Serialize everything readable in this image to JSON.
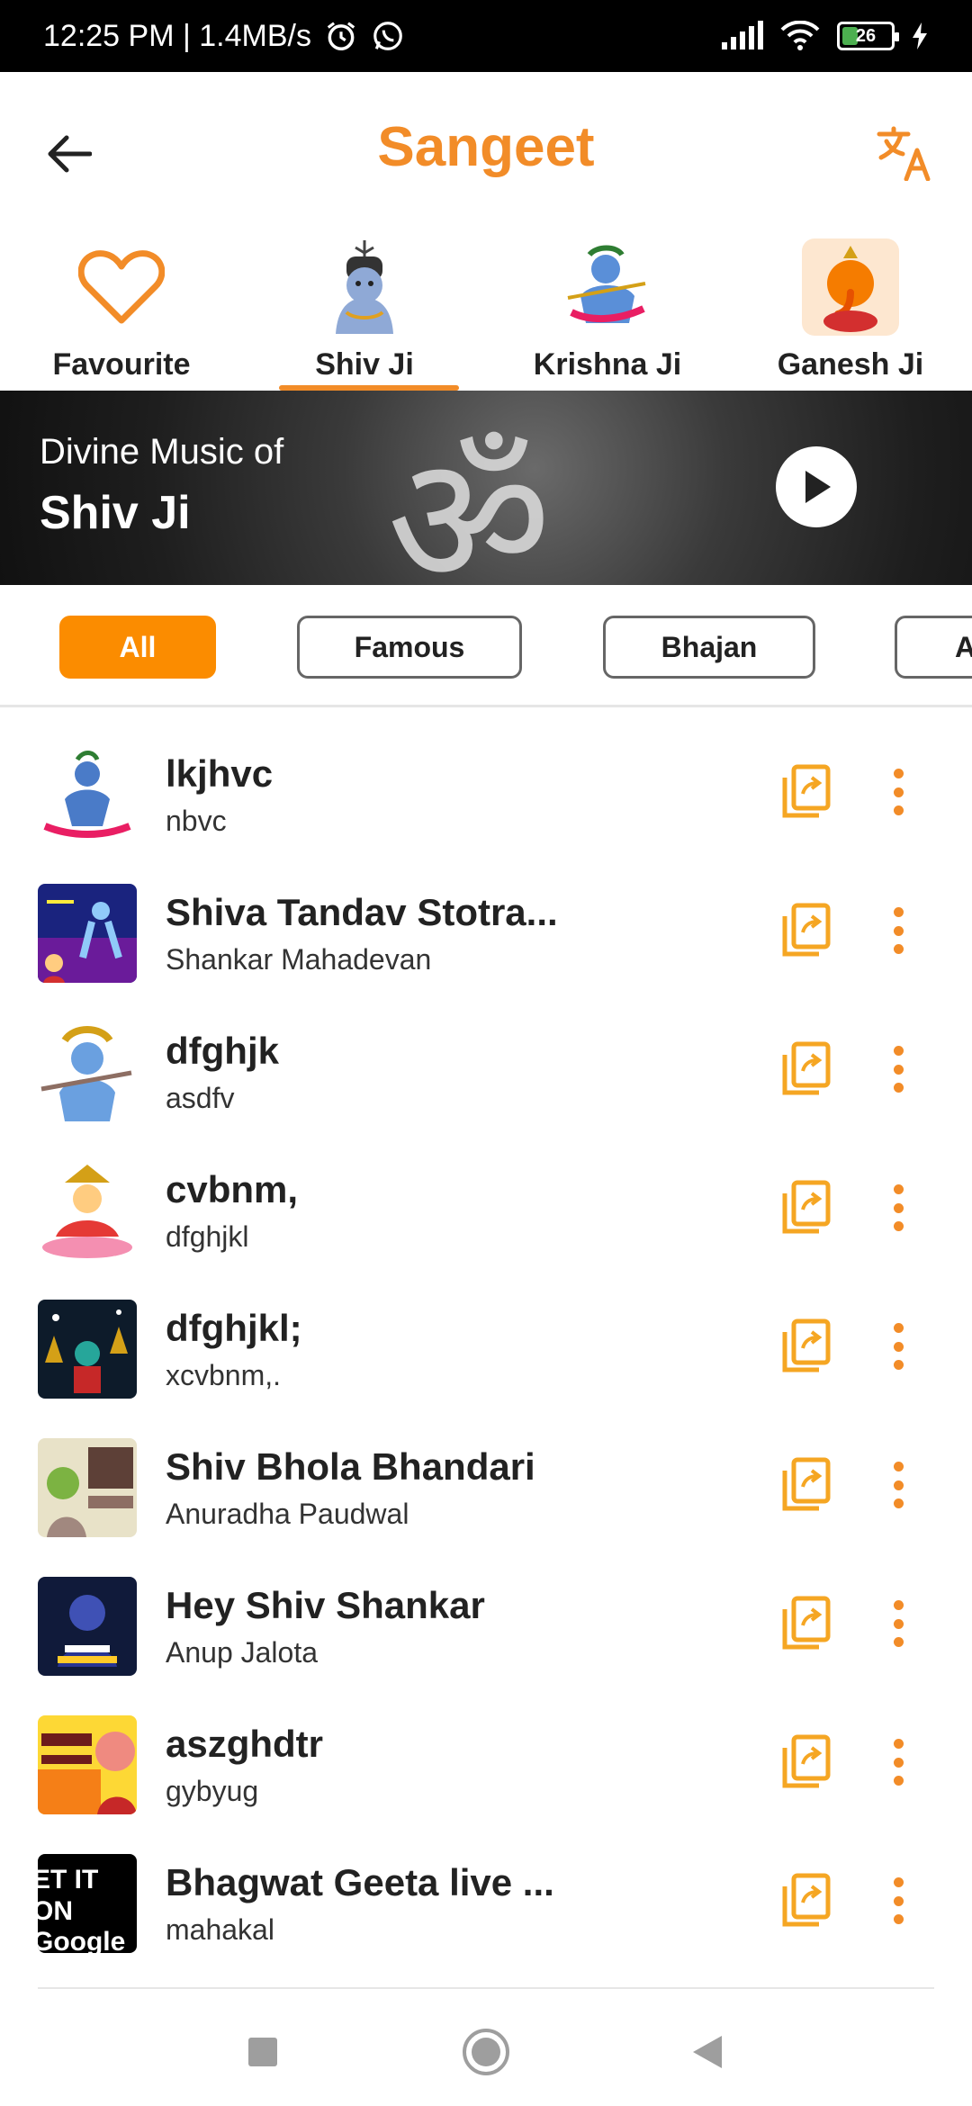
{
  "status_bar": {
    "time_speed": "12:25 PM | 1.4MB/s",
    "battery": "26",
    "icons": [
      "alarm-icon",
      "whatsapp-icon",
      "signal-icon",
      "wifi-icon",
      "battery-icon",
      "charging-icon"
    ]
  },
  "app_bar": {
    "title": "Sangeet",
    "back_icon": "back-arrow-icon",
    "translate_icon": "translate-icon"
  },
  "tabs": [
    {
      "label": "Favourite",
      "icon": "heart-icon"
    },
    {
      "label": "Shiv Ji",
      "icon": "shiv-ji-image"
    },
    {
      "label": "Krishna Ji",
      "icon": "krishna-ji-image"
    },
    {
      "label": "Ganesh Ji",
      "icon": "ganesh-ji-image"
    }
  ],
  "active_tab": "Shiv Ji",
  "banner": {
    "line1": "Divine Music of",
    "line2": "Shiv Ji"
  },
  "filters": [
    "All",
    "Famous",
    "Bhajan",
    "A"
  ],
  "active_filter": "All",
  "songs": [
    {
      "title": "lkjhvc",
      "subtitle": "nbvc"
    },
    {
      "title": "Shiva Tandav Stotra...",
      "subtitle": "Shankar Mahadevan"
    },
    {
      "title": "dfghjk",
      "subtitle": "asdfv"
    },
    {
      "title": "cvbnm,",
      "subtitle": "dfghjkl"
    },
    {
      "title": "dfghjkl;",
      "subtitle": "xcvbnm,."
    },
    {
      "title": "Shiv Bhola Bhandari",
      "subtitle": "Anuradha Paudwal"
    },
    {
      "title": "Hey Shiv Shankar",
      "subtitle": "Anup Jalota"
    },
    {
      "title": "aszghdtr",
      "subtitle": "gybyug"
    },
    {
      "title": "Bhagwat Geeta live ...",
      "subtitle": "mahakal"
    }
  ],
  "song_artwork_text": {
    "row9": "ET IT ON Google"
  },
  "colors": {
    "accent": "#f28c28",
    "chip_active": "#fb8c00",
    "status_bar": "#000000"
  },
  "nav_bar": [
    "recent-apps-button",
    "home-button",
    "back-button"
  ]
}
